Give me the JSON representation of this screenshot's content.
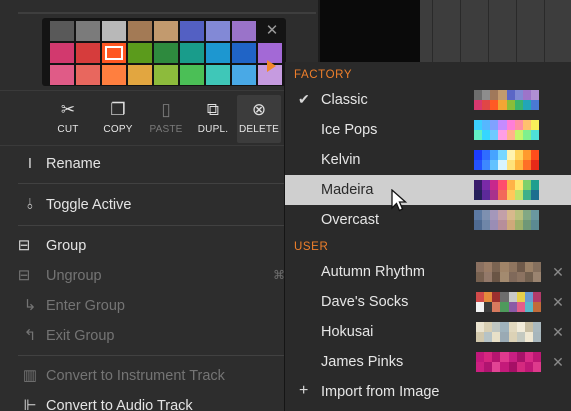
{
  "palette": {
    "rows": [
      [
        "#595959",
        "#7b7b7b",
        "#b8b8b8",
        "#a37a55",
        "#c29a6e",
        "#5360c3",
        "#8289d6",
        "#9a73c9",
        "#ffffff00"
      ],
      [
        "#d2396e",
        "#d63c3c",
        "#ff5722",
        "#5b9b1c",
        "#2e8a3e",
        "#199c8b",
        "#1d97d0",
        "#2064c6",
        "#a369d6"
      ],
      [
        "#e05b87",
        "#e8675e",
        "#ff7f3f",
        "#e2a640",
        "#8dbb3c",
        "#4bbf56",
        "#3fc7b8",
        "#49a9e6",
        "#c69be0"
      ]
    ],
    "selected_index": [
      1,
      2
    ],
    "close_icon": "close-icon",
    "submenu_arrow_color": "#f1882a"
  },
  "edit_actions": [
    {
      "label": "CUT",
      "icon": "scissors-icon",
      "glyph": "✂",
      "enabled": true
    },
    {
      "label": "COPY",
      "icon": "copy-icon",
      "glyph": "❐",
      "enabled": true
    },
    {
      "label": "PASTE",
      "icon": "paste-icon",
      "glyph": "▯",
      "enabled": false
    },
    {
      "label": "DUPL.",
      "icon": "duplicate-icon",
      "glyph": "⧉",
      "enabled": true
    },
    {
      "label": "DELETE",
      "icon": "delete-icon",
      "glyph": "⊗",
      "enabled": true
    }
  ],
  "menu": {
    "rename": "Rename",
    "toggle_active": "Toggle Active",
    "group": "Group",
    "ungroup": "Ungroup",
    "ungroup_shortcut": "⌘",
    "enter_group": "Enter Group",
    "exit_group": "Exit Group",
    "convert_instrument": "Convert to Instrument Track",
    "convert_audio": "Convert to Audio Track"
  },
  "palettes_menu": {
    "factory_header": "FACTORY",
    "user_header": "USER",
    "accent_color": "#ef7f2b",
    "factory": [
      {
        "name": "Classic",
        "checked": true,
        "colors": [
          "#6d6d6d",
          "#8d8d8d",
          "#a0785a",
          "#c29a6e",
          "#5b66c6",
          "#8089d4",
          "#9d74c9",
          "#b08fd4",
          "#d8386f",
          "#e04646",
          "#ff5a24",
          "#f1a634",
          "#8bbd39",
          "#3ab46c",
          "#22a6b7",
          "#4a79d3"
        ]
      },
      {
        "name": "Ice Pops",
        "checked": false,
        "colors": [
          "#3bd0ff",
          "#56b7ff",
          "#7fa2ff",
          "#c58bff",
          "#ff7ed8",
          "#ff8fa3",
          "#ffc06e",
          "#f8ef5a",
          "#62f0c3",
          "#35d6ff",
          "#6fc9ff",
          "#ff9ee5",
          "#ffb38a",
          "#c4f56b",
          "#7ef08e",
          "#4ee0d7"
        ]
      },
      {
        "name": "Kelvin",
        "checked": false,
        "colors": [
          "#1c3cff",
          "#2f6dff",
          "#46a4ff",
          "#77d7ff",
          "#fff3b0",
          "#ffd35a",
          "#ff9a2e",
          "#ff4d1c",
          "#2352ff",
          "#3d88ff",
          "#62c2ff",
          "#d8f4ff",
          "#ffe27a",
          "#ffb63e",
          "#ff7026",
          "#e82a18"
        ]
      },
      {
        "name": "Madeira",
        "checked": false,
        "highlight": true,
        "colors": [
          "#3a1c6b",
          "#7a2aa8",
          "#c8288c",
          "#ff4d6d",
          "#ffb347",
          "#ffe66d",
          "#7fd06b",
          "#1f9e8f",
          "#25205a",
          "#5c2a9a",
          "#a8328c",
          "#f26a5a",
          "#ffc85a",
          "#bfe36a",
          "#3fb08a",
          "#1d6f8f"
        ]
      },
      {
        "name": "Overcast",
        "checked": false,
        "colors": [
          "#5d7aa3",
          "#7e90b0",
          "#a497ba",
          "#c3a0a8",
          "#d8b98c",
          "#b9c07d",
          "#82a884",
          "#6a98a0",
          "#4f6b92",
          "#6f86a8",
          "#9a8db5",
          "#b78e9a",
          "#cfa97a",
          "#9fb06a",
          "#6f9877",
          "#5b8a92"
        ]
      }
    ],
    "user": [
      {
        "name": "Autumn Rhythm",
        "colors": [
          "#8a7060",
          "#9a7c66",
          "#7b6452",
          "#a08468",
          "#8f755f",
          "#6f5a4a",
          "#9b8167",
          "#85705e",
          "#776150",
          "#93796a",
          "#6a5545",
          "#a38a6f",
          "#80695a",
          "#8c7361",
          "#72604f",
          "#9a8470"
        ]
      },
      {
        "name": "Dave's Socks",
        "colors": [
          "#d24a4a",
          "#e58a3c",
          "#9c2f2f",
          "#6d6d6d",
          "#c9c9c9",
          "#e6d04b",
          "#6a9ad0",
          "#b33a6a",
          "#f2f2f2",
          "#3a3a3a",
          "#d77a5e",
          "#4e9a5c",
          "#8a5aa6",
          "#e35e8a",
          "#58b8c9",
          "#c06b3a"
        ]
      },
      {
        "name": "Hokusai",
        "colors": [
          "#eae3cf",
          "#d8ceb2",
          "#bfc6c2",
          "#9fb3bd",
          "#e2d9bf",
          "#f2ecda",
          "#c9bfa3",
          "#aab9bf",
          "#d1c7ab",
          "#b6c3c6",
          "#e8e0c8",
          "#9aaab4",
          "#dcd2b6",
          "#c4c9c0",
          "#f0e8d2",
          "#a7b6bc"
        ]
      },
      {
        "name": "James Pinks",
        "colors": [
          "#c2187b",
          "#d6267f",
          "#b5156f",
          "#e03a8e",
          "#c91f82",
          "#a8126a",
          "#d92b86",
          "#bc1874",
          "#cc2080",
          "#b01470",
          "#e24494",
          "#c41a7a",
          "#a60f66",
          "#d5297f",
          "#bf1876",
          "#de3a8c"
        ]
      }
    ],
    "import_label": "Import from Image"
  }
}
